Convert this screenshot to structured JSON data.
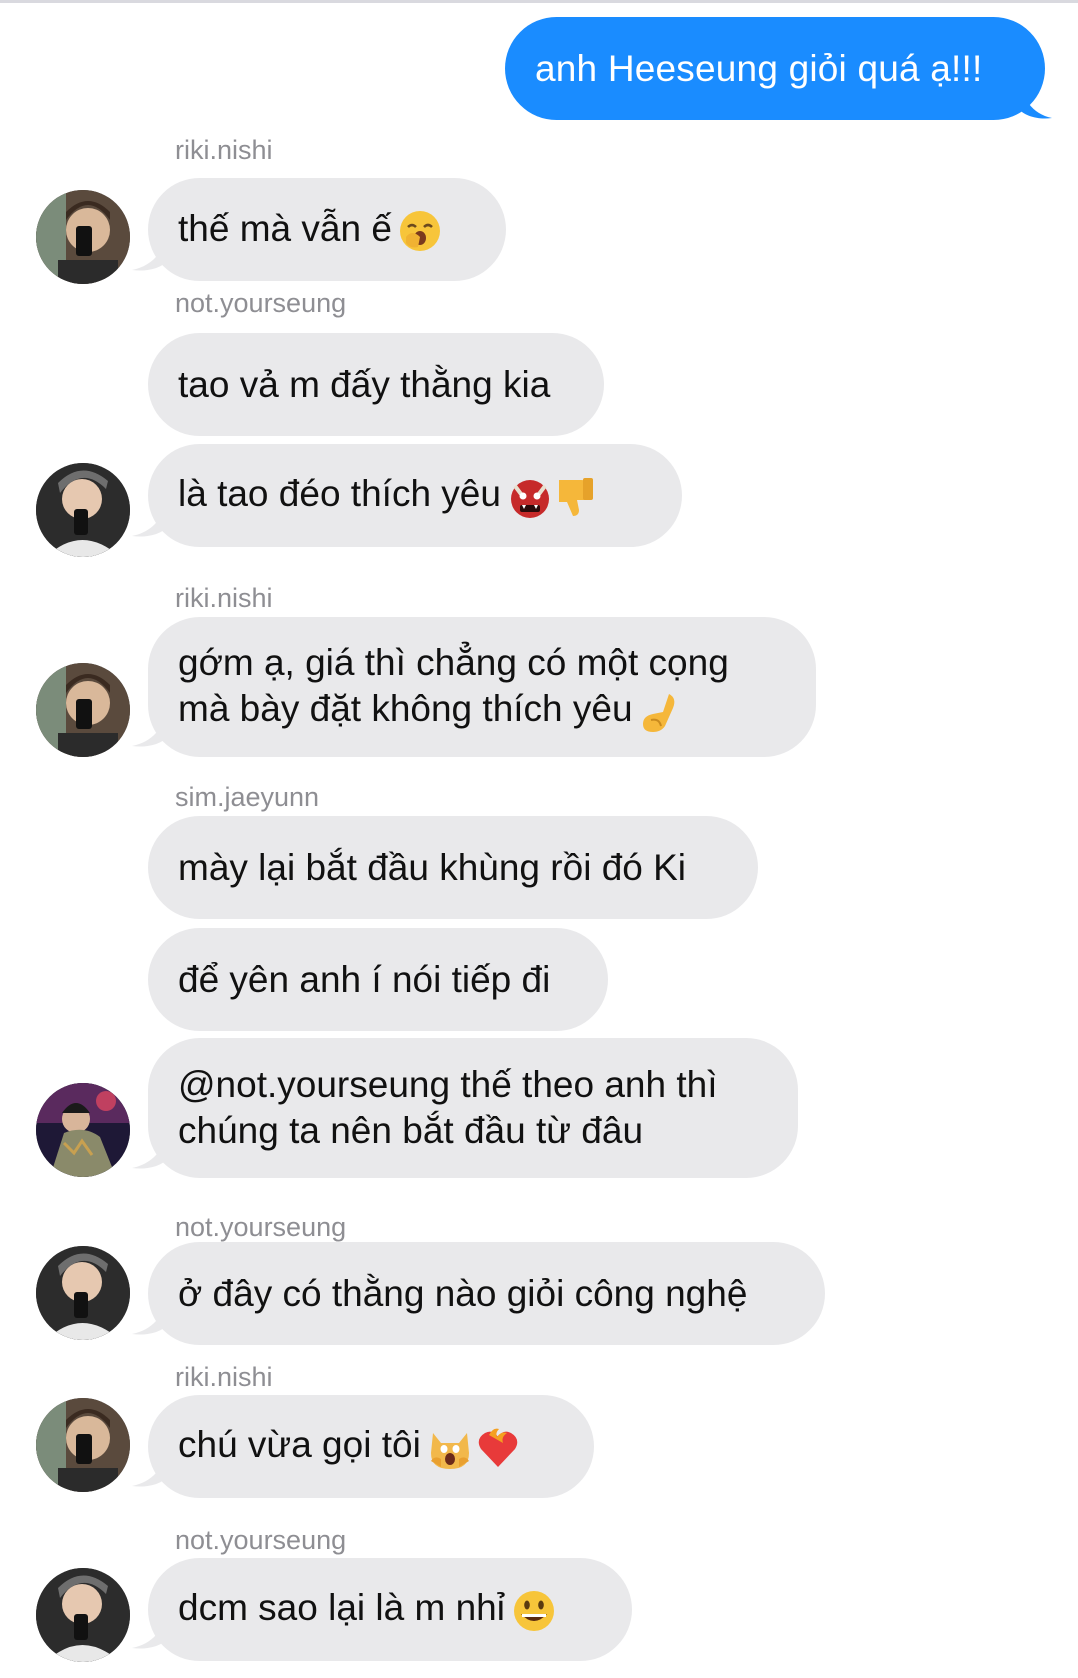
{
  "outgoing": {
    "text": "anh Heeseung giỏi quá ạ!!!",
    "color": "#1a8cff"
  },
  "messages": [
    {
      "sender": "riki.nishi",
      "lines": [
        "thế mà vẫn ế"
      ],
      "emoji": [
        "yawning-face"
      ]
    },
    {
      "sender": "not.yourseung",
      "lines": [
        "tao vả m đấy thằng kia"
      ],
      "emoji": []
    },
    {
      "sender": "",
      "lines": [
        "là tao đéo thích yêu"
      ],
      "emoji": [
        "ogre-face",
        "thumbs-down"
      ]
    },
    {
      "sender": "riki.nishi",
      "lines": [
        "gớm ạ, giá thì chẳng có một cọng",
        "mà bày đặt không thích yêu"
      ],
      "emoji": [
        "pinching-hand"
      ]
    },
    {
      "sender": "sim.jaeyunn",
      "lines": [
        "mày lại bắt đầu khùng rồi đó Ki"
      ],
      "emoji": []
    },
    {
      "sender": "",
      "lines": [
        "để yên anh í nói tiếp đi"
      ],
      "emoji": []
    },
    {
      "sender": "",
      "lines": [
        "@not.yourseung thế theo anh thì",
        "chúng ta nên bắt đầu từ đâu"
      ],
      "emoji": []
    },
    {
      "sender": "not.yourseung",
      "lines": [
        "ở đây có thằng nào giỏi công nghệ"
      ],
      "emoji": []
    },
    {
      "sender": "riki.nishi",
      "lines": [
        "chú vừa gọi tôi"
      ],
      "emoji": [
        "weary-cat",
        "heart-on-fire"
      ]
    },
    {
      "sender": "not.yourseung",
      "lines": [
        "dcm sao lại là m nhỉ"
      ],
      "emoji": [
        "grinning-face"
      ]
    }
  ],
  "colors": {
    "incoming_bubble": "#e9e9eb",
    "sender_label": "#8e8e93",
    "background": "#ffffff"
  }
}
